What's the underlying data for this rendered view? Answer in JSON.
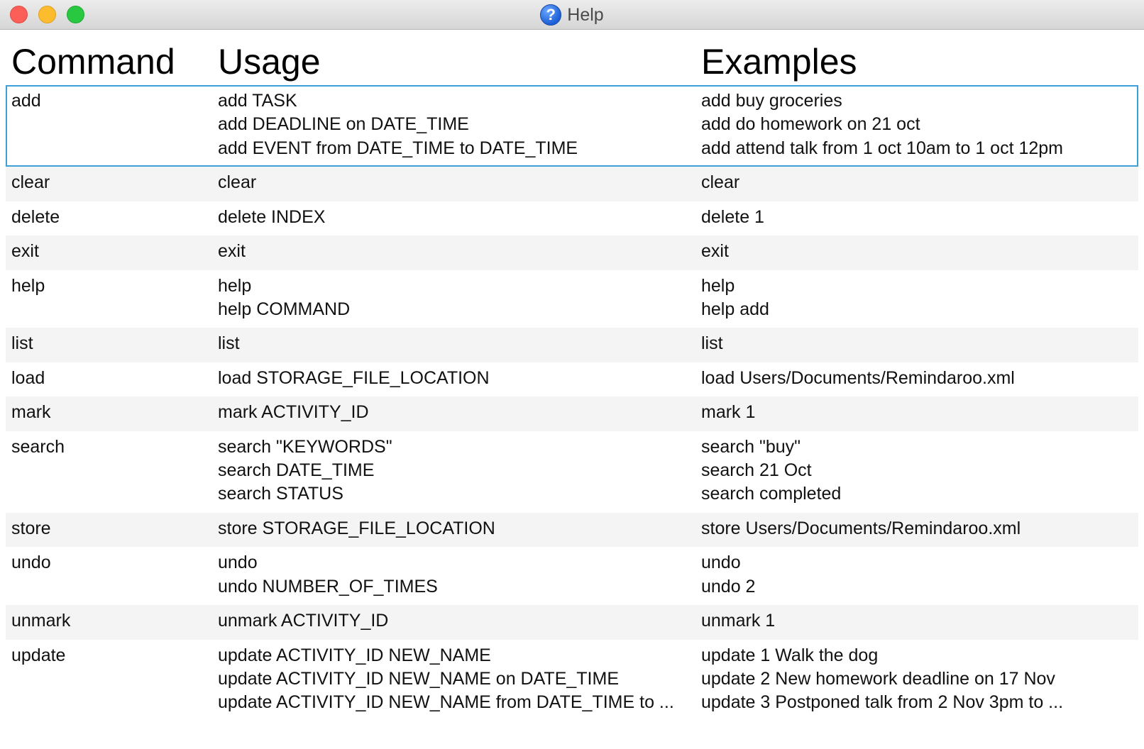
{
  "window": {
    "title": "Help",
    "title_icon": "help-question-icon",
    "colors": {
      "selection_border": "#3ea0d8",
      "alt_row": "#f4f4f4",
      "close": "#fc5f57",
      "minimize": "#fdbc2e",
      "zoom": "#28c840"
    }
  },
  "table": {
    "headers": {
      "command": "Command",
      "usage": "Usage",
      "examples": "Examples"
    },
    "rows": [
      {
        "command": "add",
        "usage": [
          "add TASK",
          "add DEADLINE on DATE_TIME",
          "add EVENT from DATE_TIME to DATE_TIME"
        ],
        "examples": [
          "add buy groceries",
          "add do homework on 21 oct",
          "add attend talk from 1 oct 10am to 1 oct 12pm"
        ],
        "selected": true
      },
      {
        "command": "clear",
        "usage": [
          "clear"
        ],
        "examples": [
          "clear"
        ]
      },
      {
        "command": "delete",
        "usage": [
          "delete INDEX"
        ],
        "examples": [
          "delete 1"
        ]
      },
      {
        "command": "exit",
        "usage": [
          "exit"
        ],
        "examples": [
          "exit"
        ]
      },
      {
        "command": "help",
        "usage": [
          "help",
          "help COMMAND"
        ],
        "examples": [
          "help",
          "help add"
        ]
      },
      {
        "command": "list",
        "usage": [
          "list"
        ],
        "examples": [
          "list"
        ]
      },
      {
        "command": "load",
        "usage": [
          "load STORAGE_FILE_LOCATION"
        ],
        "examples": [
          "load Users/Documents/Remindaroo.xml"
        ]
      },
      {
        "command": "mark",
        "usage": [
          "mark ACTIVITY_ID"
        ],
        "examples": [
          "mark 1"
        ]
      },
      {
        "command": "search",
        "usage": [
          "search \"KEYWORDS\"",
          "search DATE_TIME",
          "search STATUS"
        ],
        "examples": [
          "search \"buy\"",
          "search 21 Oct",
          "search completed"
        ]
      },
      {
        "command": "store",
        "usage": [
          "store STORAGE_FILE_LOCATION"
        ],
        "examples": [
          "store Users/Documents/Remindaroo.xml"
        ]
      },
      {
        "command": "undo",
        "usage": [
          "undo",
          "undo NUMBER_OF_TIMES"
        ],
        "examples": [
          "undo",
          "undo 2"
        ]
      },
      {
        "command": "unmark",
        "usage": [
          "unmark ACTIVITY_ID"
        ],
        "examples": [
          "unmark 1"
        ]
      },
      {
        "command": "update",
        "usage": [
          "update ACTIVITY_ID NEW_NAME",
          "update ACTIVITY_ID NEW_NAME on DATE_TIME",
          "update ACTIVITY_ID NEW_NAME from DATE_TIME to ..."
        ],
        "examples": [
          "update 1 Walk the dog",
          "update 2 New homework deadline on 17 Nov",
          "update 3 Postponed talk from 2 Nov 3pm to ..."
        ]
      }
    ]
  }
}
